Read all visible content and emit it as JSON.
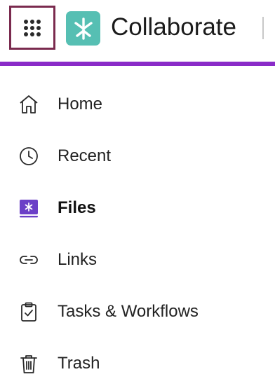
{
  "header": {
    "app_name": "Collaborate",
    "launcher_icon": "grid-dots-icon",
    "logo_icon": "asterisk-logo-icon",
    "logo_color": "#56bfb3",
    "accent_color": "#8a2bc8",
    "launcher_border_color": "#7a2a4e"
  },
  "nav": {
    "items": [
      {
        "label": "Home",
        "icon": "home-icon",
        "active": false
      },
      {
        "label": "Recent",
        "icon": "clock-icon",
        "active": false
      },
      {
        "label": "Files",
        "icon": "files-icon",
        "active": true
      },
      {
        "label": "Links",
        "icon": "link-icon",
        "active": false
      },
      {
        "label": "Tasks & Workflows",
        "icon": "clipboard-check-icon",
        "active": false
      },
      {
        "label": "Trash",
        "icon": "trash-icon",
        "active": false
      }
    ],
    "active_color": "#6b3fc7"
  }
}
